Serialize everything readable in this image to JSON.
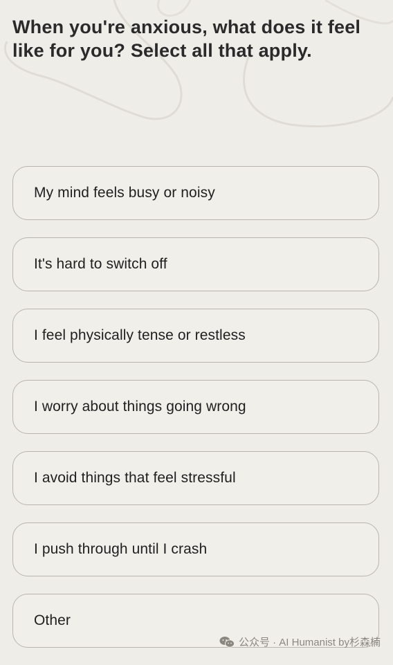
{
  "question": {
    "text": "When you're anxious, what does it feel like for you? Select all that apply."
  },
  "options": [
    {
      "label": "My mind feels busy or noisy"
    },
    {
      "label": "It's hard to switch off"
    },
    {
      "label": "I feel physically tense or restless"
    },
    {
      "label": "I worry about things going wrong"
    },
    {
      "label": "I avoid things that feel stressful"
    },
    {
      "label": "I push through until I crash"
    },
    {
      "label": "Other"
    }
  ],
  "watermark": {
    "icon": "wechat-icon",
    "text": "公众号 · AI Humanist by杉森楠"
  },
  "colors": {
    "background": "#efede8",
    "option_border": "#b8b5ae",
    "text": "#1f1f1f"
  }
}
